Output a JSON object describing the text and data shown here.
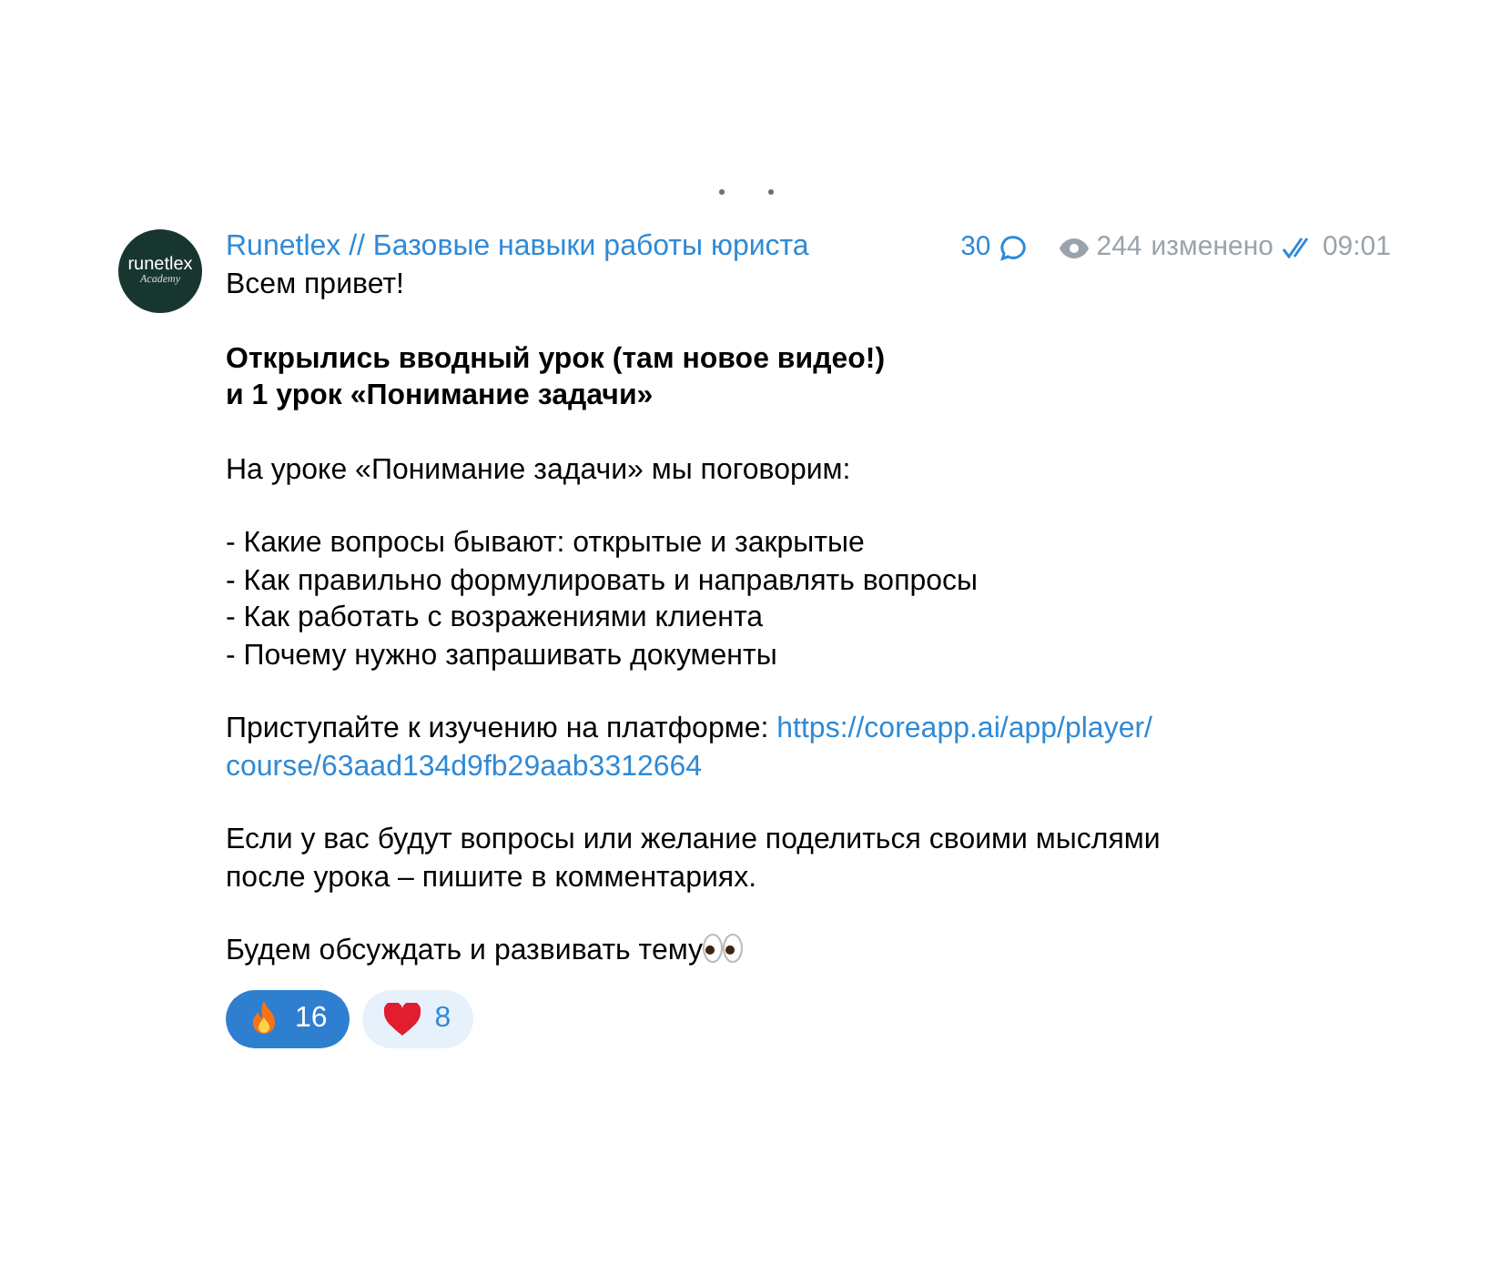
{
  "post": {
    "avatar_text": "runetlex",
    "avatar_subtext": "Academy",
    "channel": "Runetlex // Базовые навыки работы юриста",
    "comments": "30",
    "views": "244",
    "edited": "изменено",
    "read": true,
    "time": "09:01",
    "paragraphs": [
      {
        "kind": "text",
        "lines": [
          "Всем привет!"
        ]
      },
      {
        "kind": "bold",
        "lines": [
          "Открылись вводный урок (там новое видео!)",
          "и 1 урок  «Понимание задачи»"
        ]
      },
      {
        "kind": "text",
        "lines": [
          "На уроке «Понимание задачи» мы поговорим:"
        ]
      },
      {
        "kind": "text",
        "lines": [
          "- Какие вопросы бывают: открытые и закрытые",
          "- Как правильно формулировать и направлять вопросы",
          "- Как работать с возражениями клиента",
          "- Почему нужно запрашивать документы"
        ]
      },
      {
        "kind": "link",
        "lines": [
          "Приступайте к изучению на платформе: "
        ],
        "link_lines": [
          "https://coreapp.ai/app/player/",
          "course/63aad134d9fb29aab3312664"
        ]
      },
      {
        "kind": "text",
        "lines": [
          "Если у вас будут вопросы или желание поделиться своими мыслями",
          "после урока – пишите в комментариях."
        ]
      },
      {
        "kind": "eyes",
        "lines": [
          "Будем обсуждать и развивать тему"
        ]
      }
    ],
    "reactions": [
      {
        "kind": "fire",
        "count": "16",
        "selected": true
      },
      {
        "kind": "heart",
        "count": "8",
        "selected": false
      }
    ]
  }
}
